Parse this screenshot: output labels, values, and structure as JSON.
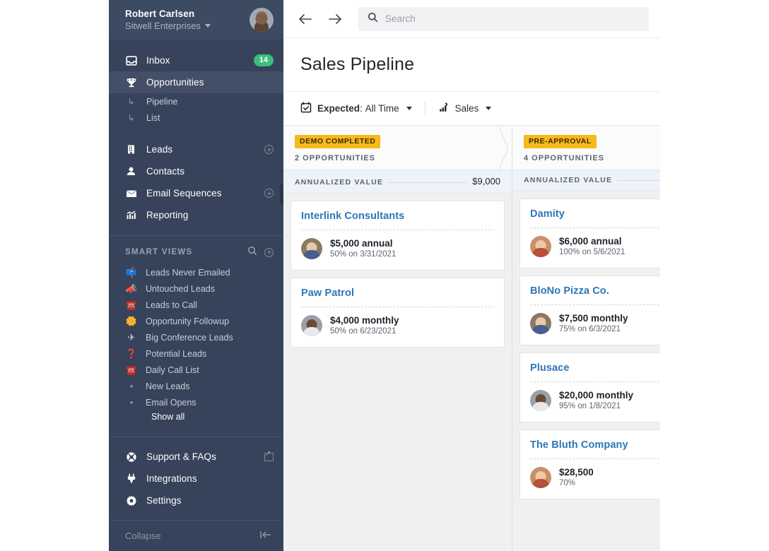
{
  "sidebar": {
    "user": {
      "name": "Robert Carlsen",
      "org": "Sitwell Enterprises"
    },
    "nav": [
      {
        "label": "Inbox",
        "icon": "inbox-icon",
        "badge": "14"
      },
      {
        "label": "Opportunities",
        "icon": "trophy-icon",
        "active": true
      }
    ],
    "sub_items": [
      {
        "label": "Pipeline"
      },
      {
        "label": "List"
      }
    ],
    "nav2": [
      {
        "label": "Leads",
        "icon": "building-icon",
        "add": true
      },
      {
        "label": "Contacts",
        "icon": "person-icon",
        "add": false
      },
      {
        "label": "Email Sequences",
        "icon": "envelope-icon",
        "add": true
      },
      {
        "label": "Reporting",
        "icon": "bar-chart-icon",
        "add": false
      }
    ],
    "smart_views": {
      "title": "SMART VIEWS",
      "items": [
        {
          "label": "Leads Never Emailed",
          "emoji": "📫"
        },
        {
          "label": "Untouched Leads",
          "emoji": "📣"
        },
        {
          "label": "Leads to Call",
          "emoji": "☎️"
        },
        {
          "label": "Opportunity Followup",
          "emoji": "🌼"
        },
        {
          "label": "Big Conference Leads",
          "emoji": "✈"
        },
        {
          "label": "Potential Leads",
          "emoji": "❓"
        },
        {
          "label": "Daily Call List",
          "emoji": "☎️"
        },
        {
          "label": "New Leads",
          "emoji": "•"
        },
        {
          "label": "Email Opens",
          "emoji": "•"
        }
      ],
      "show_all": "Show all"
    },
    "bottom": [
      {
        "label": "Support & FAQs",
        "icon": "lifebuoy-icon",
        "external": true
      },
      {
        "label": "Integrations",
        "icon": "plug-icon",
        "external": false
      },
      {
        "label": "Settings",
        "icon": "gear-icon",
        "external": false
      }
    ],
    "collapse": "Collapse"
  },
  "topbar": {
    "search_placeholder": "Search"
  },
  "page": {
    "title": "Sales Pipeline"
  },
  "filters": {
    "date_label": "Expected",
    "date_sep": ":",
    "date_value": "All Time",
    "pipeline_value": "Sales"
  },
  "board": {
    "columns": [
      {
        "stage": "DEMO COMPLETED",
        "count": "2 OPPORTUNITIES",
        "value_label": "ANNUALIZED VALUE",
        "value_amount": "$9,000",
        "cards": [
          {
            "title": "Interlink Consultants",
            "amount": "$5,000 annual",
            "sub": "50% on 3/31/2021",
            "avatar_face": "#e8c8a8",
            "avatar_body": "#4a5d8f",
            "avatar_bg": "#8a7a63"
          },
          {
            "title": "Paw Patrol",
            "amount": "$4,000 monthly",
            "sub": "50% on 6/23/2021",
            "avatar_face": "#6b4a34",
            "avatar_body": "#e8e8ea",
            "avatar_bg": "#9aa0aa"
          }
        ]
      },
      {
        "stage": "PRE-APPROVAL",
        "count": "4 OPPORTUNITIES",
        "value_label": "ANNUALIZED VALUE",
        "value_amount": "",
        "cards": [
          {
            "title": "Damity",
            "amount": "$6,000 annual",
            "sub": "100% on 5/6/2021",
            "avatar_face": "#f0c7a4",
            "avatar_body": "#b5503a",
            "avatar_bg": "#c98f6a"
          },
          {
            "title": "BloNo Pizza Co.",
            "amount": "$7,500 monthly",
            "sub": "75% on 6/3/2021",
            "avatar_face": "#e8c8a8",
            "avatar_body": "#4a5d8f",
            "avatar_bg": "#8a7a63"
          },
          {
            "title": "Plusace",
            "amount": "$20,000 monthly",
            "sub": "95% on 1/8/2021",
            "avatar_face": "#6b4a34",
            "avatar_body": "#e8e8ea",
            "avatar_bg": "#9aa0aa"
          },
          {
            "title": "The Bluth Company",
            "amount": "$28,500",
            "sub": "70%",
            "avatar_face": "#f0c7a4",
            "avatar_body": "#b5503a",
            "avatar_bg": "#c98f6a"
          }
        ]
      }
    ]
  },
  "colors": {
    "sidebar_bg": "#36435a",
    "sidebar_active": "#434f66",
    "badge_green": "#3cbd7d",
    "stage_amber": "#f7b81c",
    "card_title_blue": "#2e76b8",
    "value_band": "#eef3fa"
  }
}
